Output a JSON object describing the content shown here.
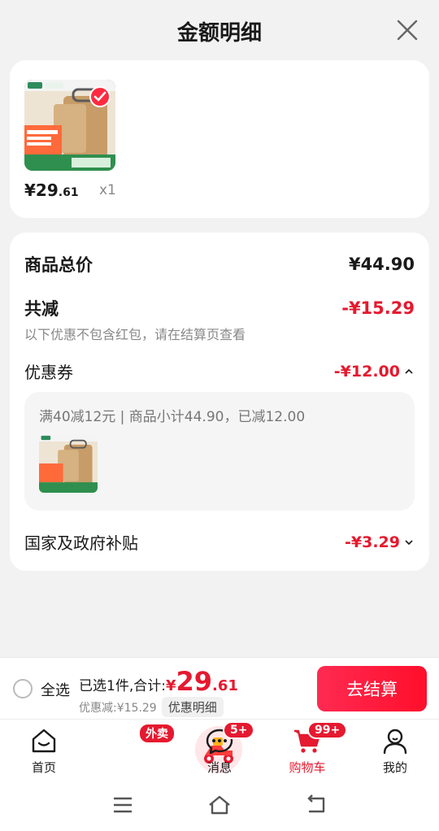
{
  "sheet": {
    "title": "金额明细"
  },
  "product": {
    "price_yen": "¥",
    "price_int": "29",
    "price_dec": ".61",
    "qty": "x1"
  },
  "detail": {
    "total_label": "商品总价",
    "total_value": "¥44.90",
    "reduce_label": "共减",
    "reduce_value": "-¥15.29",
    "reduce_note": "以下优惠不包含红包，请在结算页查看",
    "coupon_label": "优惠券",
    "coupon_value": "-¥12.00",
    "coupon_desc": "满40减12元 | 商品小计44.90，已减12.00",
    "subsidy_label": "国家及政府补贴",
    "subsidy_value": "-¥3.29"
  },
  "bottom": {
    "select_all": "全选",
    "selected_text": "已选1件,合计:",
    "sum_yen": "¥",
    "sum_int": "29",
    "sum_dec": ".61",
    "discount_note": "优惠减:¥15.29",
    "detail_pill": "优惠明细",
    "checkout": "去结算"
  },
  "tabs": [
    {
      "label": "首页"
    },
    {
      "label": "外卖",
      "badge": "外卖"
    },
    {
      "label": "消息",
      "badge": "5+"
    },
    {
      "label": "购物车",
      "badge": "99+"
    },
    {
      "label": "我的"
    }
  ],
  "colors": {
    "accent": "#e5192f",
    "background": "#f2f2f2"
  }
}
